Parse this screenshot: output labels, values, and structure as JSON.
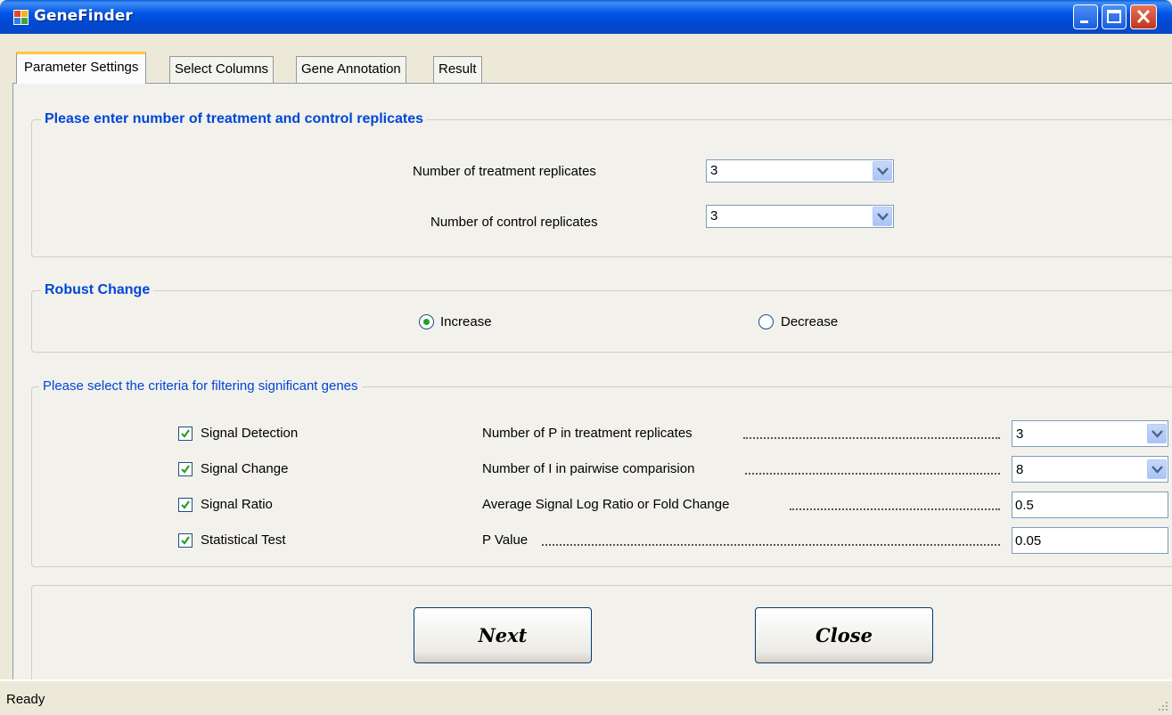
{
  "window": {
    "title": "GeneFinder"
  },
  "tabs": [
    {
      "label": "Parameter Settings",
      "active": true
    },
    {
      "label": "Select Columns",
      "active": false
    },
    {
      "label": "Gene Annotation",
      "active": false
    },
    {
      "label": "Result",
      "active": false
    }
  ],
  "replicates": {
    "title": "Please enter number of treatment and control replicates",
    "treatment_label": "Number of treatment replicates",
    "treatment_value": "3",
    "control_label": "Number of control replicates",
    "control_value": "3"
  },
  "robust_change": {
    "title": "Robust Change",
    "options": [
      {
        "label": "Increase",
        "selected": true
      },
      {
        "label": "Decrease",
        "selected": false
      }
    ]
  },
  "criteria": {
    "title": "Please select the criteria for filtering significant genes",
    "rows": [
      {
        "check_label": "Signal Detection",
        "checked": true,
        "param_label": "Number of P in treatment replicates",
        "value": "3",
        "control": "combo"
      },
      {
        "check_label": "Signal Change",
        "checked": true,
        "param_label": "Number of I in pairwise comparision",
        "value": "8",
        "control": "combo"
      },
      {
        "check_label": "Signal Ratio",
        "checked": true,
        "param_label": "Average Signal Log Ratio or Fold Change",
        "value": "0.5",
        "control": "textbox"
      },
      {
        "check_label": "Statistical Test",
        "checked": true,
        "param_label": "P Value",
        "value": "0.05",
        "control": "textbox"
      }
    ]
  },
  "buttons": {
    "next": "Next",
    "close": "Close"
  },
  "status": {
    "text": "Ready"
  },
  "colors": {
    "titlebar": "#0055e5",
    "group_title": "#0046d5",
    "tab_highlight": "#ffc83c"
  }
}
